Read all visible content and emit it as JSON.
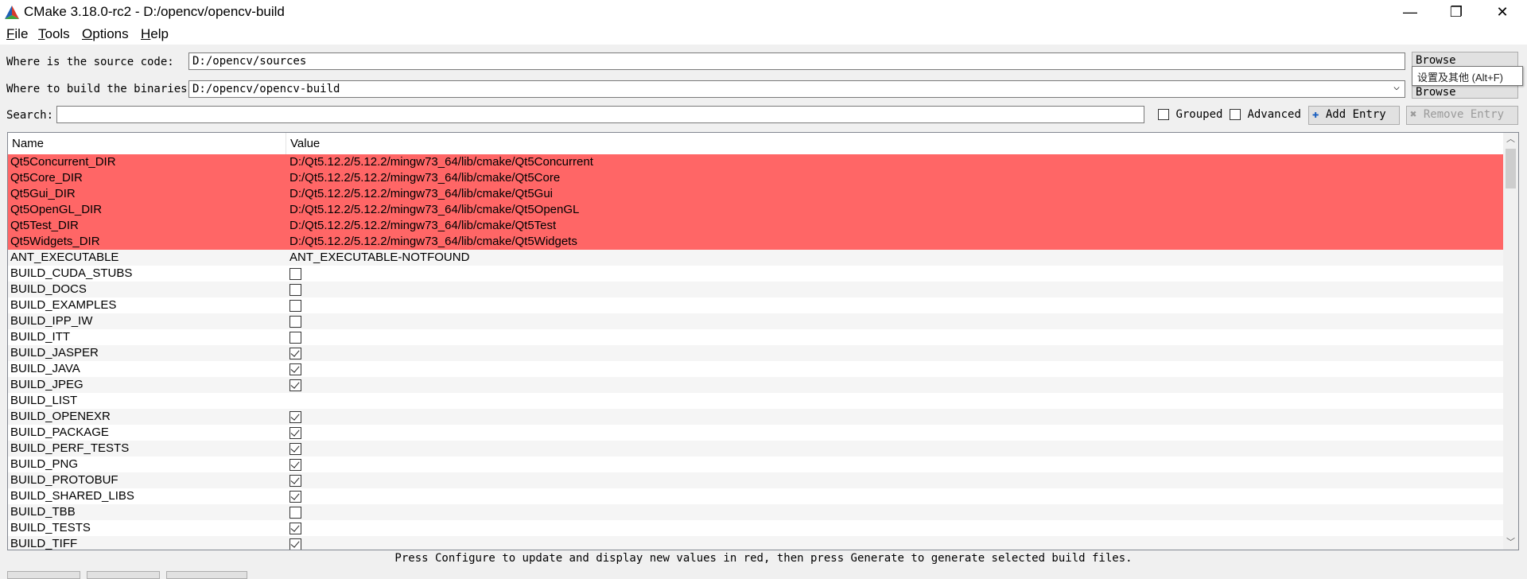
{
  "window": {
    "title": "CMake 3.18.0-rc2 - D:/opencv/opencv-build",
    "minimize_icon": "minimize-icon",
    "maximize_icon": "restore-icon",
    "close_icon": "close-icon",
    "minimize_glyph": "—",
    "restore_glyph": "❐",
    "close_glyph": "✕"
  },
  "menu": [
    {
      "label": "File",
      "mnemonic": "F",
      "rest": "ile"
    },
    {
      "label": "Tools",
      "mnemonic": "T",
      "rest": "ools"
    },
    {
      "label": "Options",
      "mnemonic": "O",
      "rest": "ptions"
    },
    {
      "label": "Help",
      "mnemonic": "H",
      "rest": "elp"
    }
  ],
  "paths": {
    "source_label": "Where is the source code:",
    "source_value": "D:/opencv/sources",
    "browse_source": "Browse Source...",
    "build_label": "Where to build the binaries:",
    "build_value": "D:/opencv/opencv-build",
    "browse_build": "Browse Build...",
    "dropdown_icon": "chevron-down-icon",
    "dropdown_glyph": "⌵"
  },
  "tooltip": "设置及其他 (Alt+F)",
  "search": {
    "label": "Search:",
    "value": "",
    "grouped_label": "Grouped",
    "grouped_checked": false,
    "advanced_label": "Advanced",
    "advanced_checked": false,
    "add_entry": "Add Entry",
    "add_icon": "plus-icon",
    "add_glyph": "✚",
    "remove_entry": "Remove Entry",
    "remove_icon": "remove-icon",
    "remove_glyph": "✖"
  },
  "table": {
    "columns": [
      "Name",
      "Value"
    ],
    "highlight_color": "#ff6666",
    "alt_row_color": "#f5f5f5",
    "rows": [
      {
        "name": "Qt5Concurrent_DIR",
        "type": "text",
        "value": "D:/Qt5.12.2/5.12.2/mingw73_64/lib/cmake/Qt5Concurrent",
        "highlight": true
      },
      {
        "name": "Qt5Core_DIR",
        "type": "text",
        "value": "D:/Qt5.12.2/5.12.2/mingw73_64/lib/cmake/Qt5Core",
        "highlight": true
      },
      {
        "name": "Qt5Gui_DIR",
        "type": "text",
        "value": "D:/Qt5.12.2/5.12.2/mingw73_64/lib/cmake/Qt5Gui",
        "highlight": true
      },
      {
        "name": "Qt5OpenGL_DIR",
        "type": "text",
        "value": "D:/Qt5.12.2/5.12.2/mingw73_64/lib/cmake/Qt5OpenGL",
        "highlight": true
      },
      {
        "name": "Qt5Test_DIR",
        "type": "text",
        "value": "D:/Qt5.12.2/5.12.2/mingw73_64/lib/cmake/Qt5Test",
        "highlight": true
      },
      {
        "name": "Qt5Widgets_DIR",
        "type": "text",
        "value": "D:/Qt5.12.2/5.12.2/mingw73_64/lib/cmake/Qt5Widgets",
        "highlight": true
      },
      {
        "name": "ANT_EXECUTABLE",
        "type": "text",
        "value": "ANT_EXECUTABLE-NOTFOUND",
        "highlight": false
      },
      {
        "name": "BUILD_CUDA_STUBS",
        "type": "bool",
        "checked": false,
        "highlight": false
      },
      {
        "name": "BUILD_DOCS",
        "type": "bool",
        "checked": false,
        "highlight": false
      },
      {
        "name": "BUILD_EXAMPLES",
        "type": "bool",
        "checked": false,
        "highlight": false
      },
      {
        "name": "BUILD_IPP_IW",
        "type": "bool",
        "checked": false,
        "highlight": false
      },
      {
        "name": "BUILD_ITT",
        "type": "bool",
        "checked": false,
        "highlight": false
      },
      {
        "name": "BUILD_JASPER",
        "type": "bool",
        "checked": true,
        "highlight": false
      },
      {
        "name": "BUILD_JAVA",
        "type": "bool",
        "checked": true,
        "highlight": false
      },
      {
        "name": "BUILD_JPEG",
        "type": "bool",
        "checked": true,
        "highlight": false
      },
      {
        "name": "BUILD_LIST",
        "type": "text",
        "value": "",
        "highlight": false
      },
      {
        "name": "BUILD_OPENEXR",
        "type": "bool",
        "checked": true,
        "highlight": false
      },
      {
        "name": "BUILD_PACKAGE",
        "type": "bool",
        "checked": true,
        "highlight": false
      },
      {
        "name": "BUILD_PERF_TESTS",
        "type": "bool",
        "checked": true,
        "highlight": false
      },
      {
        "name": "BUILD_PNG",
        "type": "bool",
        "checked": true,
        "highlight": false
      },
      {
        "name": "BUILD_PROTOBUF",
        "type": "bool",
        "checked": true,
        "highlight": false
      },
      {
        "name": "BUILD_SHARED_LIBS",
        "type": "bool",
        "checked": true,
        "highlight": false
      },
      {
        "name": "BUILD_TBB",
        "type": "bool",
        "checked": false,
        "highlight": false
      },
      {
        "name": "BUILD_TESTS",
        "type": "bool",
        "checked": true,
        "highlight": false
      },
      {
        "name": "BUILD_TIFF",
        "type": "bool",
        "checked": true,
        "highlight": false
      }
    ]
  },
  "scrollbar": {
    "up_glyph": "︿",
    "down_glyph": "﹀"
  },
  "status_text": "Press Configure to update and display new values in red, then press Generate to generate selected build files."
}
